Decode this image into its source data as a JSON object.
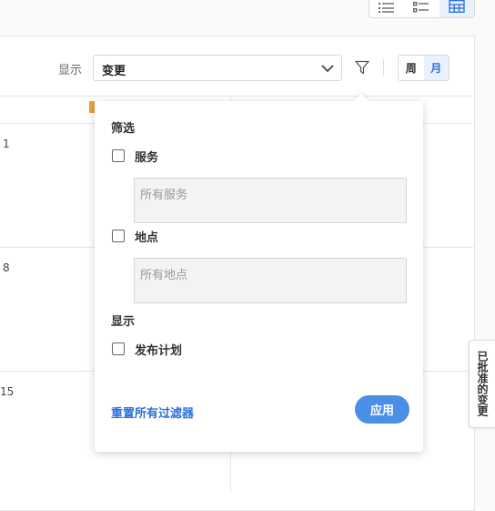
{
  "view_switcher": {
    "items": [
      {
        "icon": "list-icon",
        "active": false
      },
      {
        "icon": "checklist-icon",
        "active": false
      },
      {
        "icon": "calendar-grid-icon",
        "active": true
      }
    ]
  },
  "toolbar": {
    "display_label": "显示",
    "display_select_value": "变更",
    "filter_icon": "filter-icon",
    "period": {
      "week": "周",
      "month": "月",
      "active": "month"
    }
  },
  "calendar": {
    "day_numbers": [
      "1",
      "8",
      "15"
    ]
  },
  "filter_popover": {
    "filter_title": "筛选",
    "service": {
      "label": "服务",
      "checked": false,
      "placeholder": "所有服务"
    },
    "location": {
      "label": "地点",
      "checked": false,
      "placeholder": "所有地点"
    },
    "display_title": "显示",
    "publish_plan": {
      "label": "发布计划",
      "checked": false
    },
    "reset_label": "重置所有过滤器",
    "apply_label": "应用"
  },
  "side_tab": {
    "label": "已批准的变更"
  },
  "colors": {
    "accent": "#2a6fdb",
    "apply_button": "#4a8ee6",
    "active_bg": "#e8f1fc"
  }
}
